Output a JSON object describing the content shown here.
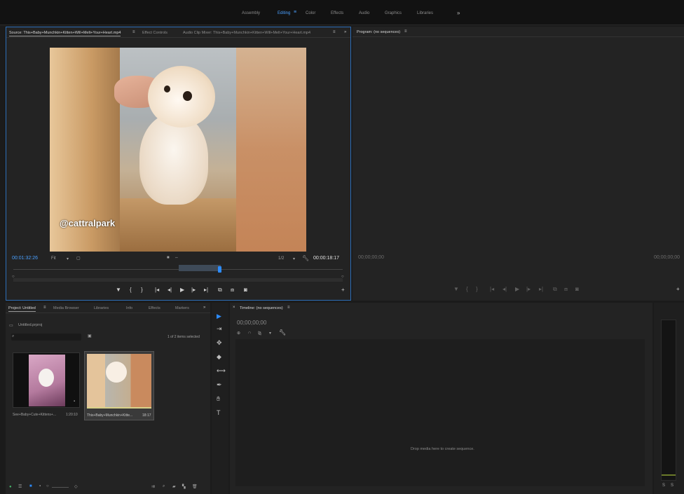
{
  "workspaces": {
    "items": [
      {
        "label": "Assembly",
        "active": false
      },
      {
        "label": "Editing",
        "active": true
      },
      {
        "label": "Color",
        "active": false
      },
      {
        "label": "Effects",
        "active": false
      },
      {
        "label": "Audio",
        "active": false
      },
      {
        "label": "Graphics",
        "active": false
      },
      {
        "label": "Libraries",
        "active": false
      }
    ],
    "menu_glyph": "≡",
    "more_glyph": "»"
  },
  "source_panel": {
    "tabs": {
      "source": "Source: This+Baby+Munchkin+Kitten+Will+Melt+Your+Heart.mp4",
      "effect_controls": "Effect Controls",
      "audio_clip_mixer": "Audio Clip Mixer: This+Baby+Munchkin+Kitten+Will+Melt+Your+Heart.mp4"
    },
    "tab_menu_glyph": "≡",
    "tab_more_glyph": "»",
    "watermark": "@cattralpark",
    "current_timecode": "00:01:32:26",
    "fit": "Fit",
    "resolution": "1/2",
    "duration_timecode": "00:00:18:17"
  },
  "program_panel": {
    "tab": "Program: (no sequences)",
    "tab_menu_glyph": "≡",
    "current_timecode": "00;00;00;00",
    "end_timecode": "00;00;00;00"
  },
  "project_panel": {
    "tabs": {
      "project": "Project: Untitled",
      "media_browser": "Media Browser",
      "libraries": "Libraries",
      "info": "Info",
      "effects": "Effects",
      "markers": "Markers"
    },
    "tab_more_glyph": "»",
    "file_name": "Untitled.prproj",
    "items_selected": "1 of 2 items selected",
    "clips": [
      {
        "name": "See+Baby+Cute+Kittens+...",
        "duration": "1:20:10"
      },
      {
        "name": "This+Baby+Munchkin+Kitte...",
        "duration": "18:17"
      }
    ]
  },
  "timeline_panel": {
    "tab": "Timeline: (no sequences)",
    "tab_menu_glyph": "≡",
    "timecode": "00;00;00;00",
    "drop_hint": "Drop media here to create sequence."
  },
  "colors": {
    "accent": "#2d8cff",
    "timecode_blue": "#4aa0ff",
    "panel_bg": "#232323",
    "app_bg": "#1b1b1b"
  }
}
